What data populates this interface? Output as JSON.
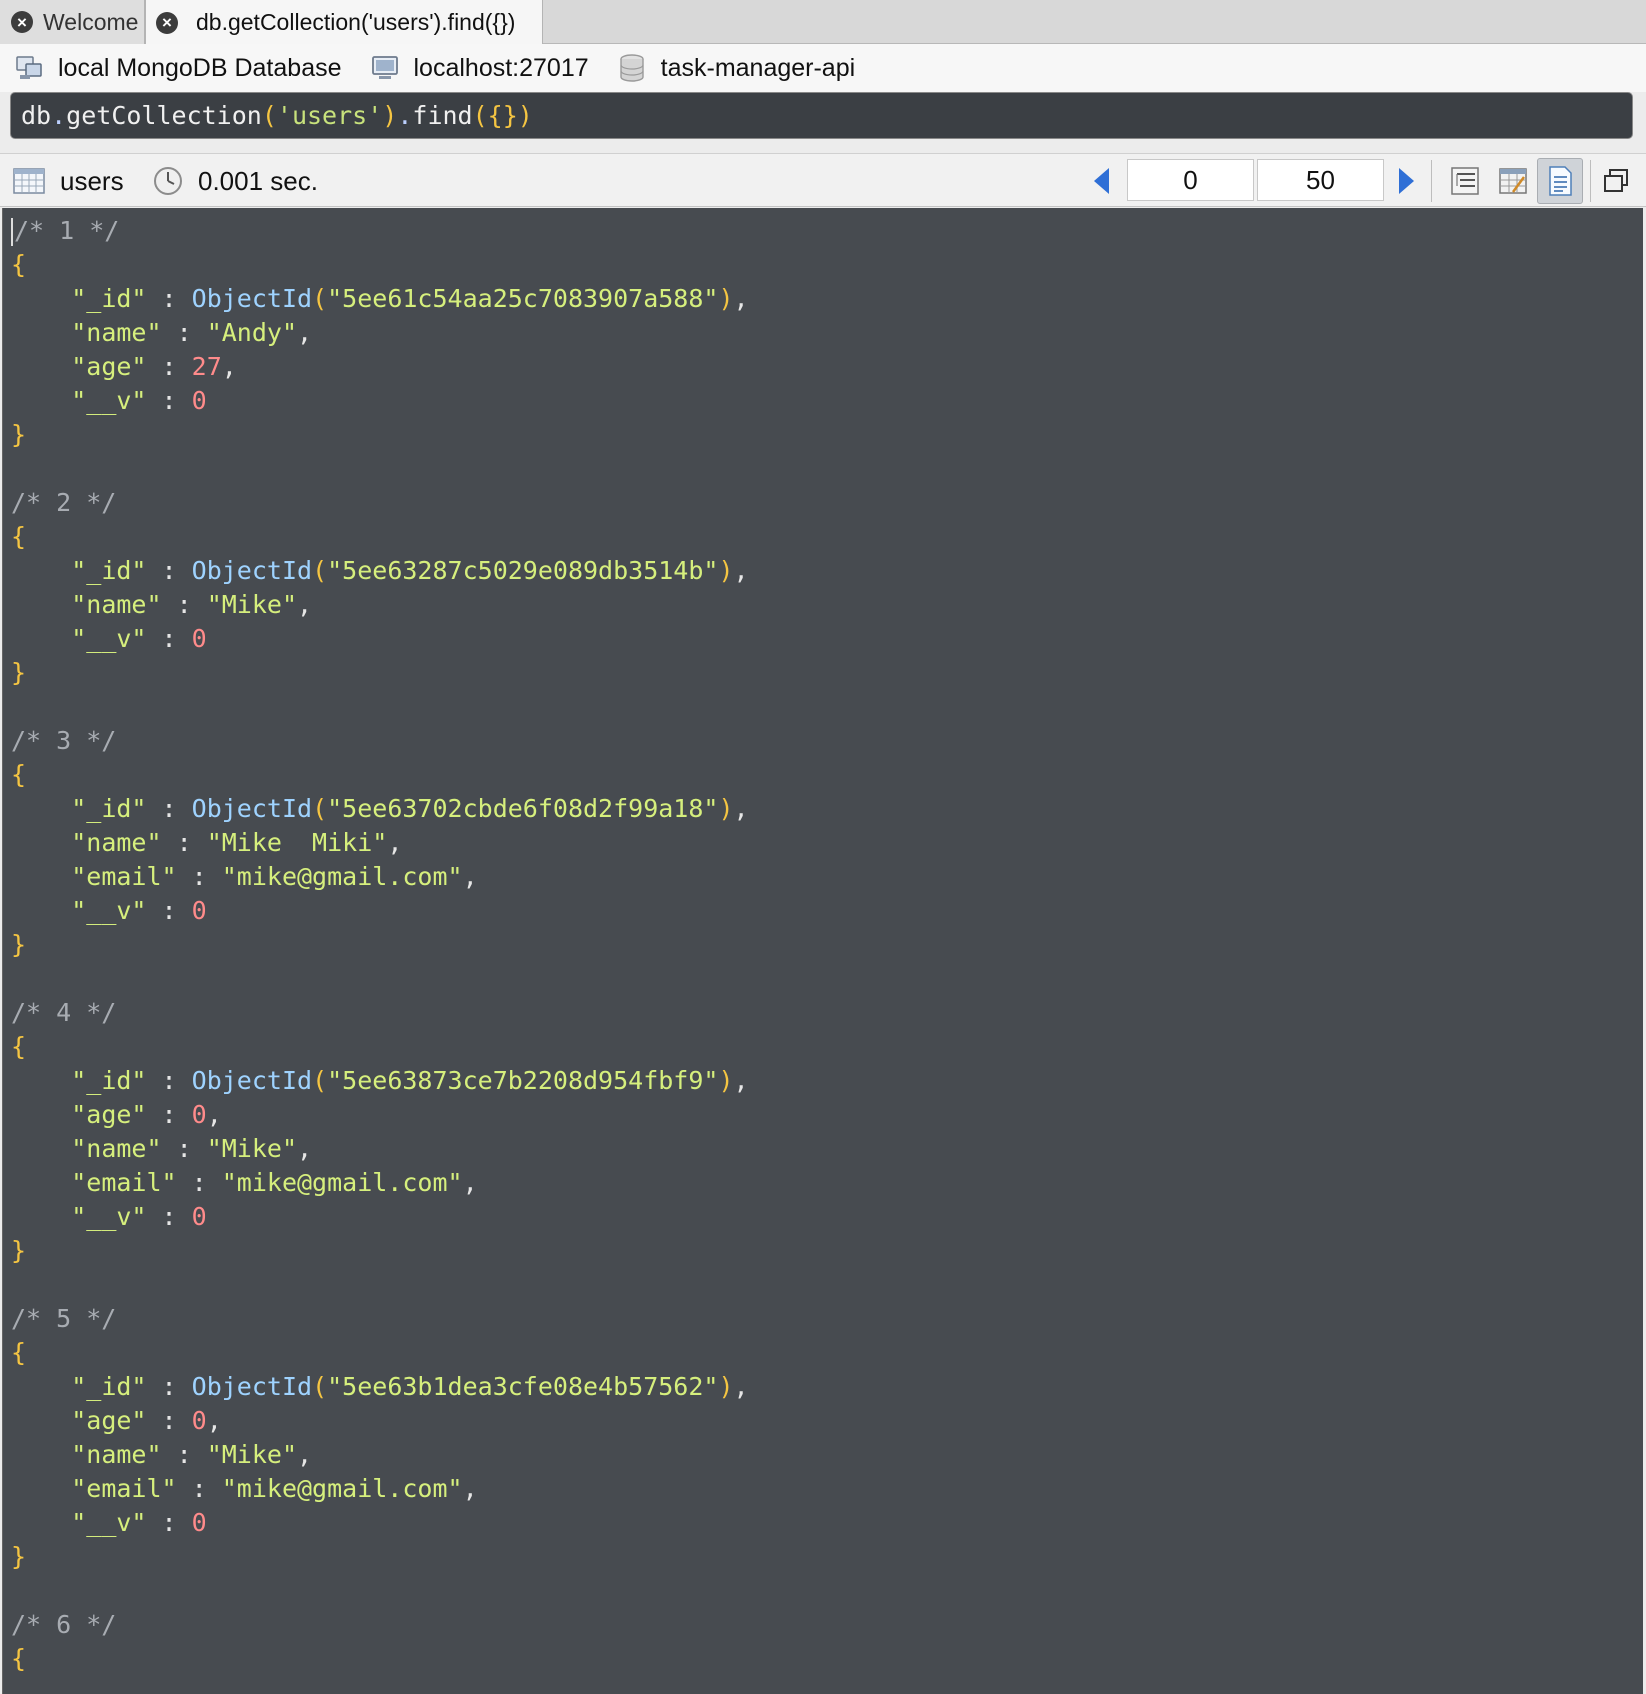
{
  "tabs": [
    {
      "label": "Welcome",
      "active": false
    },
    {
      "label": "db.getCollection('users').find({})",
      "active": true
    }
  ],
  "connection": {
    "database_label": "local MongoDB Database",
    "server_label": "localhost:27017",
    "db_name": "task-manager-api"
  },
  "query": {
    "db": "db",
    "method1": "getCollection",
    "collection": "'users'",
    "method2": "find",
    "arg": "{}"
  },
  "result_toolbar": {
    "collection": "users",
    "time": "0.001 sec.",
    "skip": "0",
    "limit": "50",
    "view_modes": [
      "tree-view",
      "table-view",
      "text-view"
    ],
    "selected_view": "text-view"
  },
  "documents": [
    {
      "comment": "/* 1 */",
      "fields": [
        {
          "key": "\"_id\"",
          "type": "oid",
          "value": "\"5ee61c54aa25c7083907a588\"",
          "comma": true
        },
        {
          "key": "\"name\"",
          "type": "str",
          "value": "\"Andy\"",
          "comma": true
        },
        {
          "key": "\"age\"",
          "type": "num",
          "value": "27",
          "comma": true
        },
        {
          "key": "\"__v\"",
          "type": "num",
          "value": "0",
          "comma": false
        }
      ]
    },
    {
      "comment": "/* 2 */",
      "fields": [
        {
          "key": "\"_id\"",
          "type": "oid",
          "value": "\"5ee63287c5029e089db3514b\"",
          "comma": true
        },
        {
          "key": "\"name\"",
          "type": "str",
          "value": "\"Mike\"",
          "comma": true
        },
        {
          "key": "\"__v\"",
          "type": "num",
          "value": "0",
          "comma": false
        }
      ]
    },
    {
      "comment": "/* 3 */",
      "fields": [
        {
          "key": "\"_id\"",
          "type": "oid",
          "value": "\"5ee63702cbde6f08d2f99a18\"",
          "comma": true
        },
        {
          "key": "\"name\"",
          "type": "str",
          "value": "\"Mike  Miki\"",
          "comma": true
        },
        {
          "key": "\"email\"",
          "type": "str",
          "value": "\"mike@gmail.com\"",
          "comma": true
        },
        {
          "key": "\"__v\"",
          "type": "num",
          "value": "0",
          "comma": false
        }
      ]
    },
    {
      "comment": "/* 4 */",
      "fields": [
        {
          "key": "\"_id\"",
          "type": "oid",
          "value": "\"5ee63873ce7b2208d954fbf9\"",
          "comma": true
        },
        {
          "key": "\"age\"",
          "type": "num",
          "value": "0",
          "comma": true
        },
        {
          "key": "\"name\"",
          "type": "str",
          "value": "\"Mike\"",
          "comma": true
        },
        {
          "key": "\"email\"",
          "type": "str",
          "value": "\"mike@gmail.com\"",
          "comma": true
        },
        {
          "key": "\"__v\"",
          "type": "num",
          "value": "0",
          "comma": false
        }
      ]
    },
    {
      "comment": "/* 5 */",
      "fields": [
        {
          "key": "\"_id\"",
          "type": "oid",
          "value": "\"5ee63b1dea3cfe08e4b57562\"",
          "comma": true
        },
        {
          "key": "\"age\"",
          "type": "num",
          "value": "0",
          "comma": true
        },
        {
          "key": "\"name\"",
          "type": "str",
          "value": "\"Mike\"",
          "comma": true
        },
        {
          "key": "\"email\"",
          "type": "str",
          "value": "\"mike@gmail.com\"",
          "comma": true
        },
        {
          "key": "\"__v\"",
          "type": "num",
          "value": "0",
          "comma": false
        }
      ]
    },
    {
      "comment": "/* 6 */",
      "fields": []
    }
  ],
  "syntax": {
    "open_brace": "{",
    "close_brace": "}",
    "separator": " : ",
    "oid_fn": "ObjectId",
    "open_paren": "(",
    "close_paren": ")",
    "comma": ","
  },
  "icons": {
    "tab_close": "close-icon",
    "connection": "database-connection-icon",
    "server": "server-monitor-icon",
    "database": "database-cylinder-icon",
    "collection": "grid-table-icon",
    "time": "clock-icon",
    "prev": "previous-page-icon",
    "next": "next-page-icon",
    "maximize": "maximize-icon"
  },
  "colors": {
    "editor_bg": "#474b50",
    "key": "#d6ef7d",
    "number": "#ff8b8b",
    "function": "#9fd3ff",
    "brace": "#f5c542",
    "comment": "#a8acb2",
    "accent_blue": "#2f6fd6"
  }
}
